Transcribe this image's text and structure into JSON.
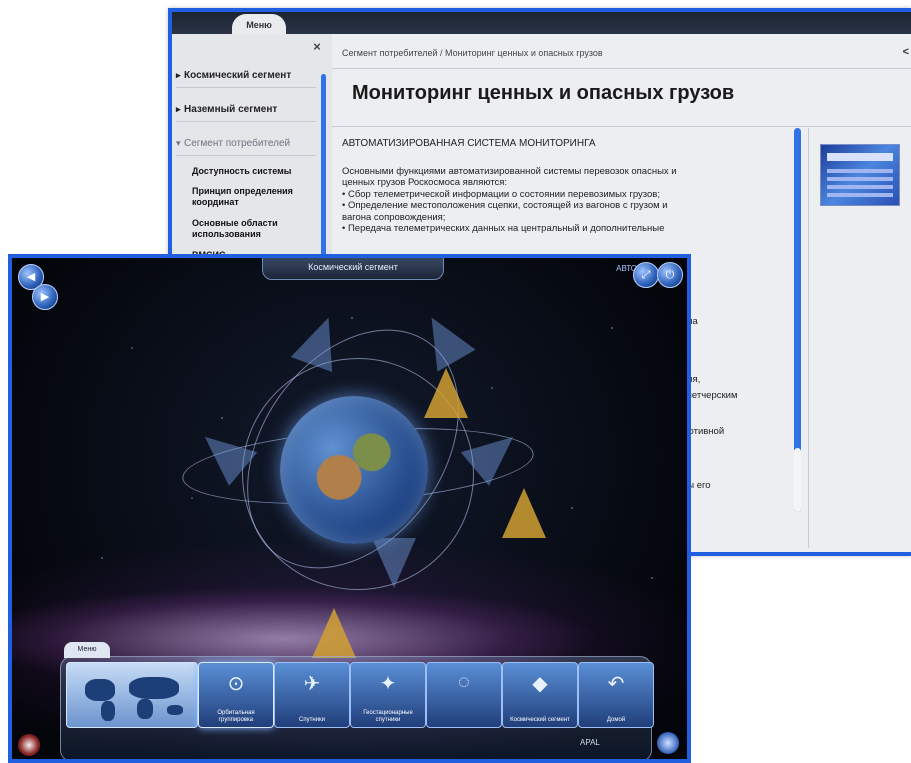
{
  "doc_window": {
    "menu_tab": "Меню",
    "close_symbol": "×",
    "collapse_symbol": "<",
    "nav": [
      {
        "label": "Космический сегмент"
      },
      {
        "label": "Наземный сегмент"
      },
      {
        "label": "Сегмент потребителей"
      }
    ],
    "sub_nav": [
      "Доступность системы",
      "Принцип определения координат",
      "Основные области использования",
      "ВМСИС"
    ],
    "breadcrumb": "Сегмент потребителей  /  Мониторинг ценных и опасных грузов",
    "page_title": "Мониторинг ценных и опасных грузов",
    "body_heading": "АВТОМАТИЗИРОВАННАЯ СИСТЕМА МОНИТОРИНГА",
    "body_lines": [
      "Основными функциями автоматизированной системы перевозок опасных и",
      "ценных грузов Роскосмоса являются:",
      "• Сбор телеметрической информации о состоянии перевозимых грузов;",
      "• Определение местоположения сцепки, состоящей из вагонов с грузом и",
      "вагона сопровождения;",
      "• Передача телеметрических данных на центральный и дополнительные"
    ],
    "overflow_fragments": [
      "она",
      "ния,",
      "спетчерским",
      "мотивной",
      "ны его"
    ]
  },
  "app_window": {
    "title": "Космический сегмент",
    "avto": "АВТО",
    "menu_tab": "Меню",
    "tiles": [
      {
        "label": "Орбитальная группировка",
        "icon": "⊙",
        "active": true
      },
      {
        "label": "Спутники",
        "icon": "✈",
        "active": false
      },
      {
        "label": "Геостационарные спутники",
        "icon": "✦",
        "active": false
      },
      {
        "label": "",
        "icon": "◌",
        "active": false
      },
      {
        "label": "Космический сегмент",
        "icon": "◆",
        "active": false
      },
      {
        "label": "Домой",
        "icon": "↶",
        "active": false
      }
    ],
    "brand": "APAL"
  }
}
